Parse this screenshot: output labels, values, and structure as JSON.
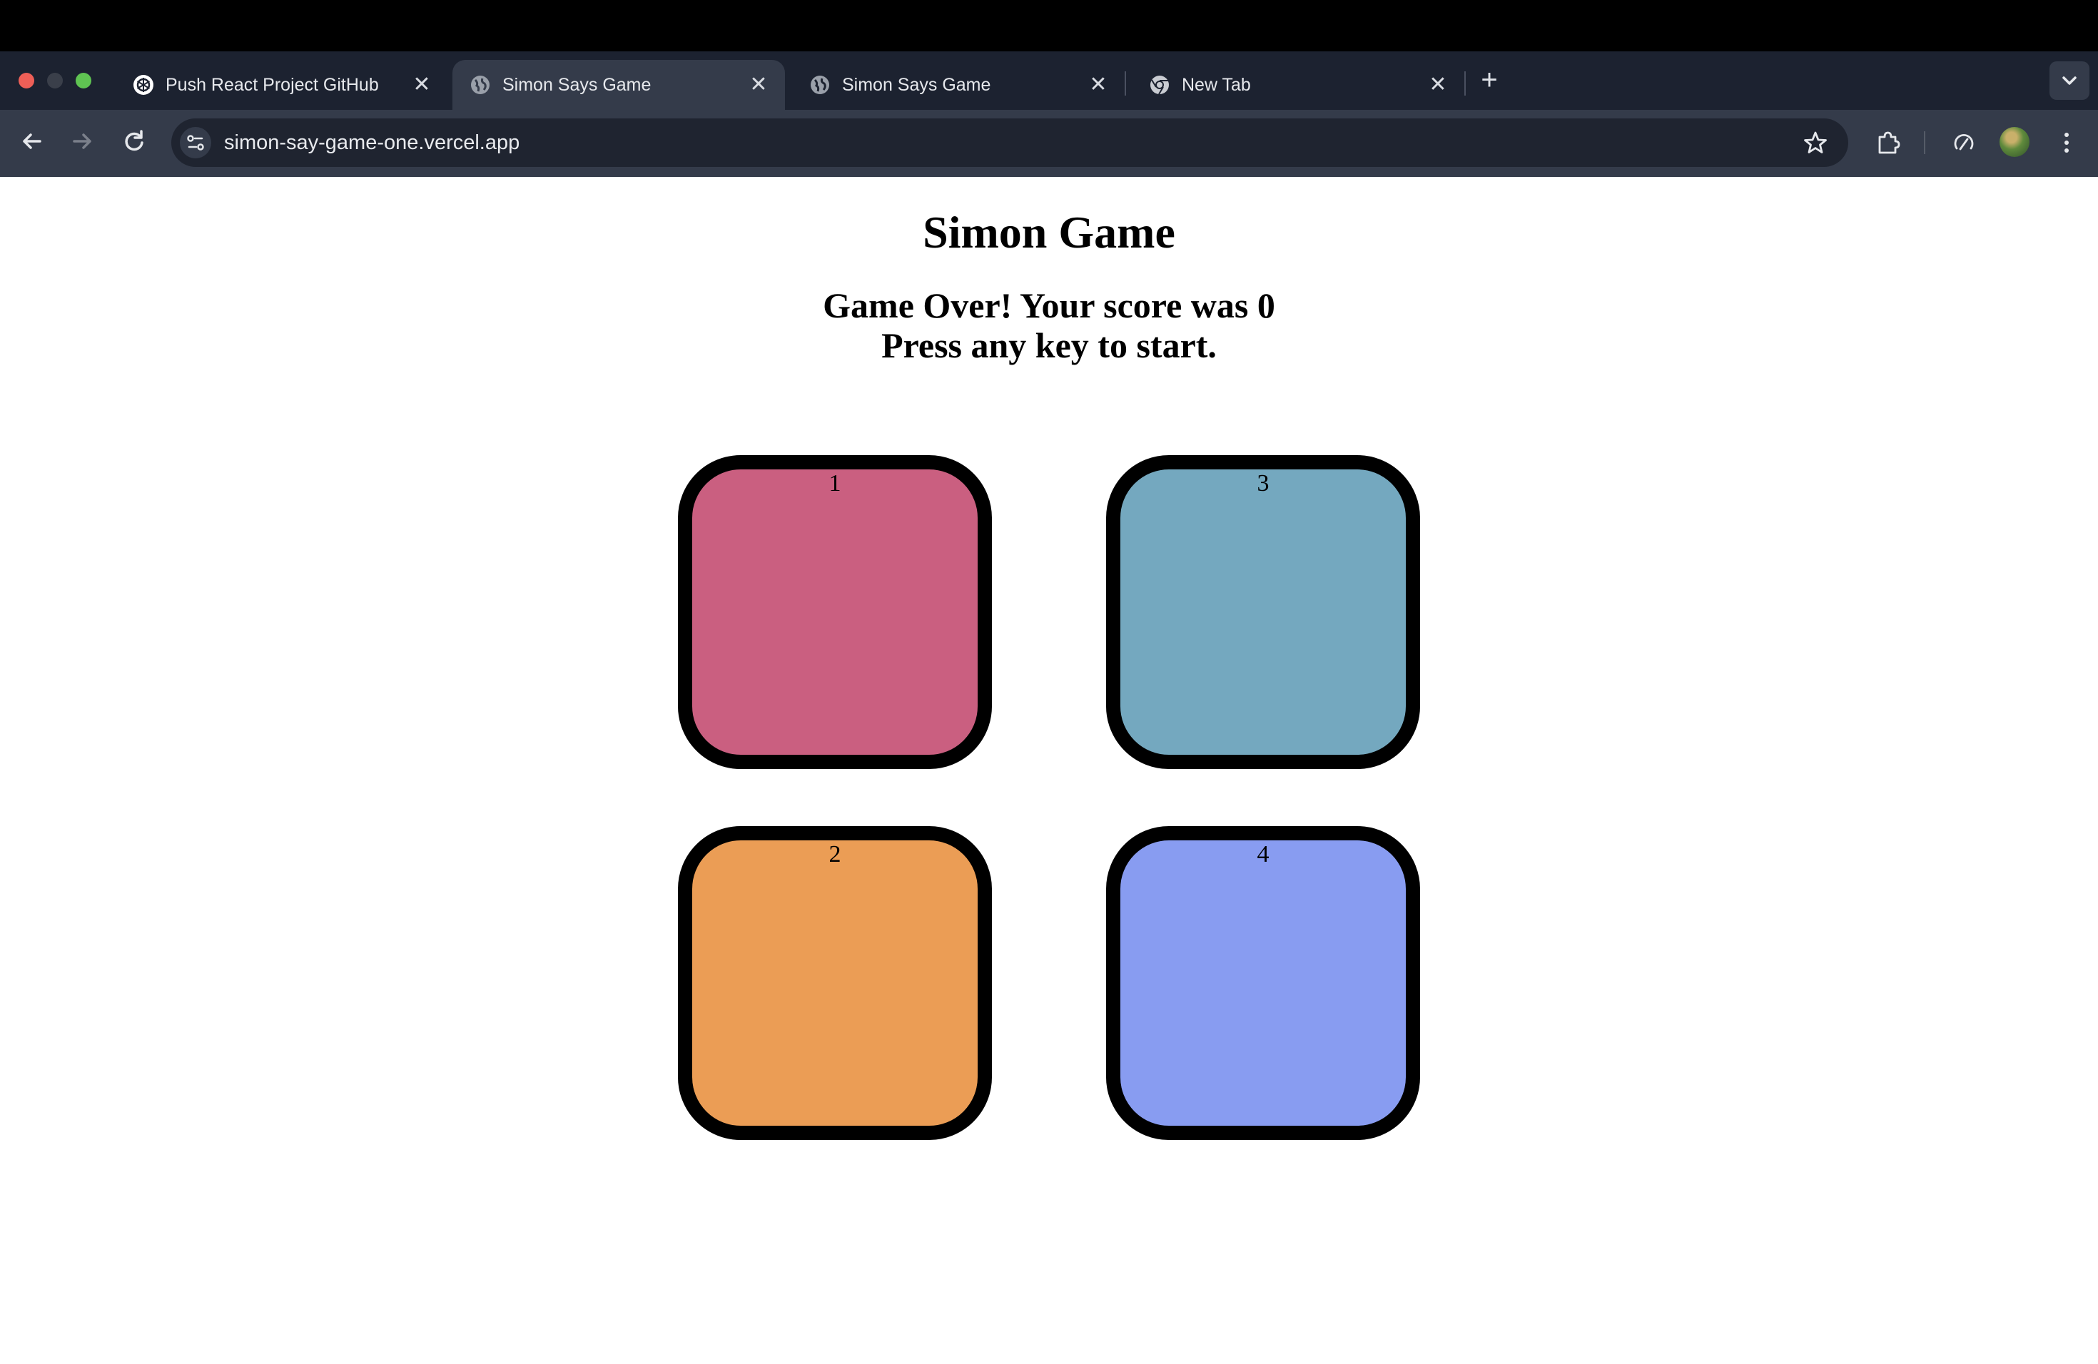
{
  "browser": {
    "tabs": [
      {
        "title": "Push React Project GitHub",
        "favicon": "chatgpt-icon",
        "active": false
      },
      {
        "title": "Simon Says Game",
        "favicon": "globe-icon",
        "active": true
      },
      {
        "title": "Simon Says Game",
        "favicon": "globe-icon",
        "active": false
      },
      {
        "title": "New Tab",
        "favicon": "chrome-icon",
        "active": false
      }
    ],
    "tab_close_glyph": "✕",
    "new_tab_glyph": "+",
    "url": "simon-say-game-one.vercel.app"
  },
  "page": {
    "title": "Simon Game",
    "status_line1": "Game Over! Your score was 0",
    "status_line2": "Press any key to start.",
    "buttons": [
      {
        "label": "1",
        "color": "#ca5f80"
      },
      {
        "label": "2",
        "color": "#eb9d55"
      },
      {
        "label": "3",
        "color": "#74a8bf"
      },
      {
        "label": "4",
        "color": "#889cf1"
      }
    ]
  }
}
